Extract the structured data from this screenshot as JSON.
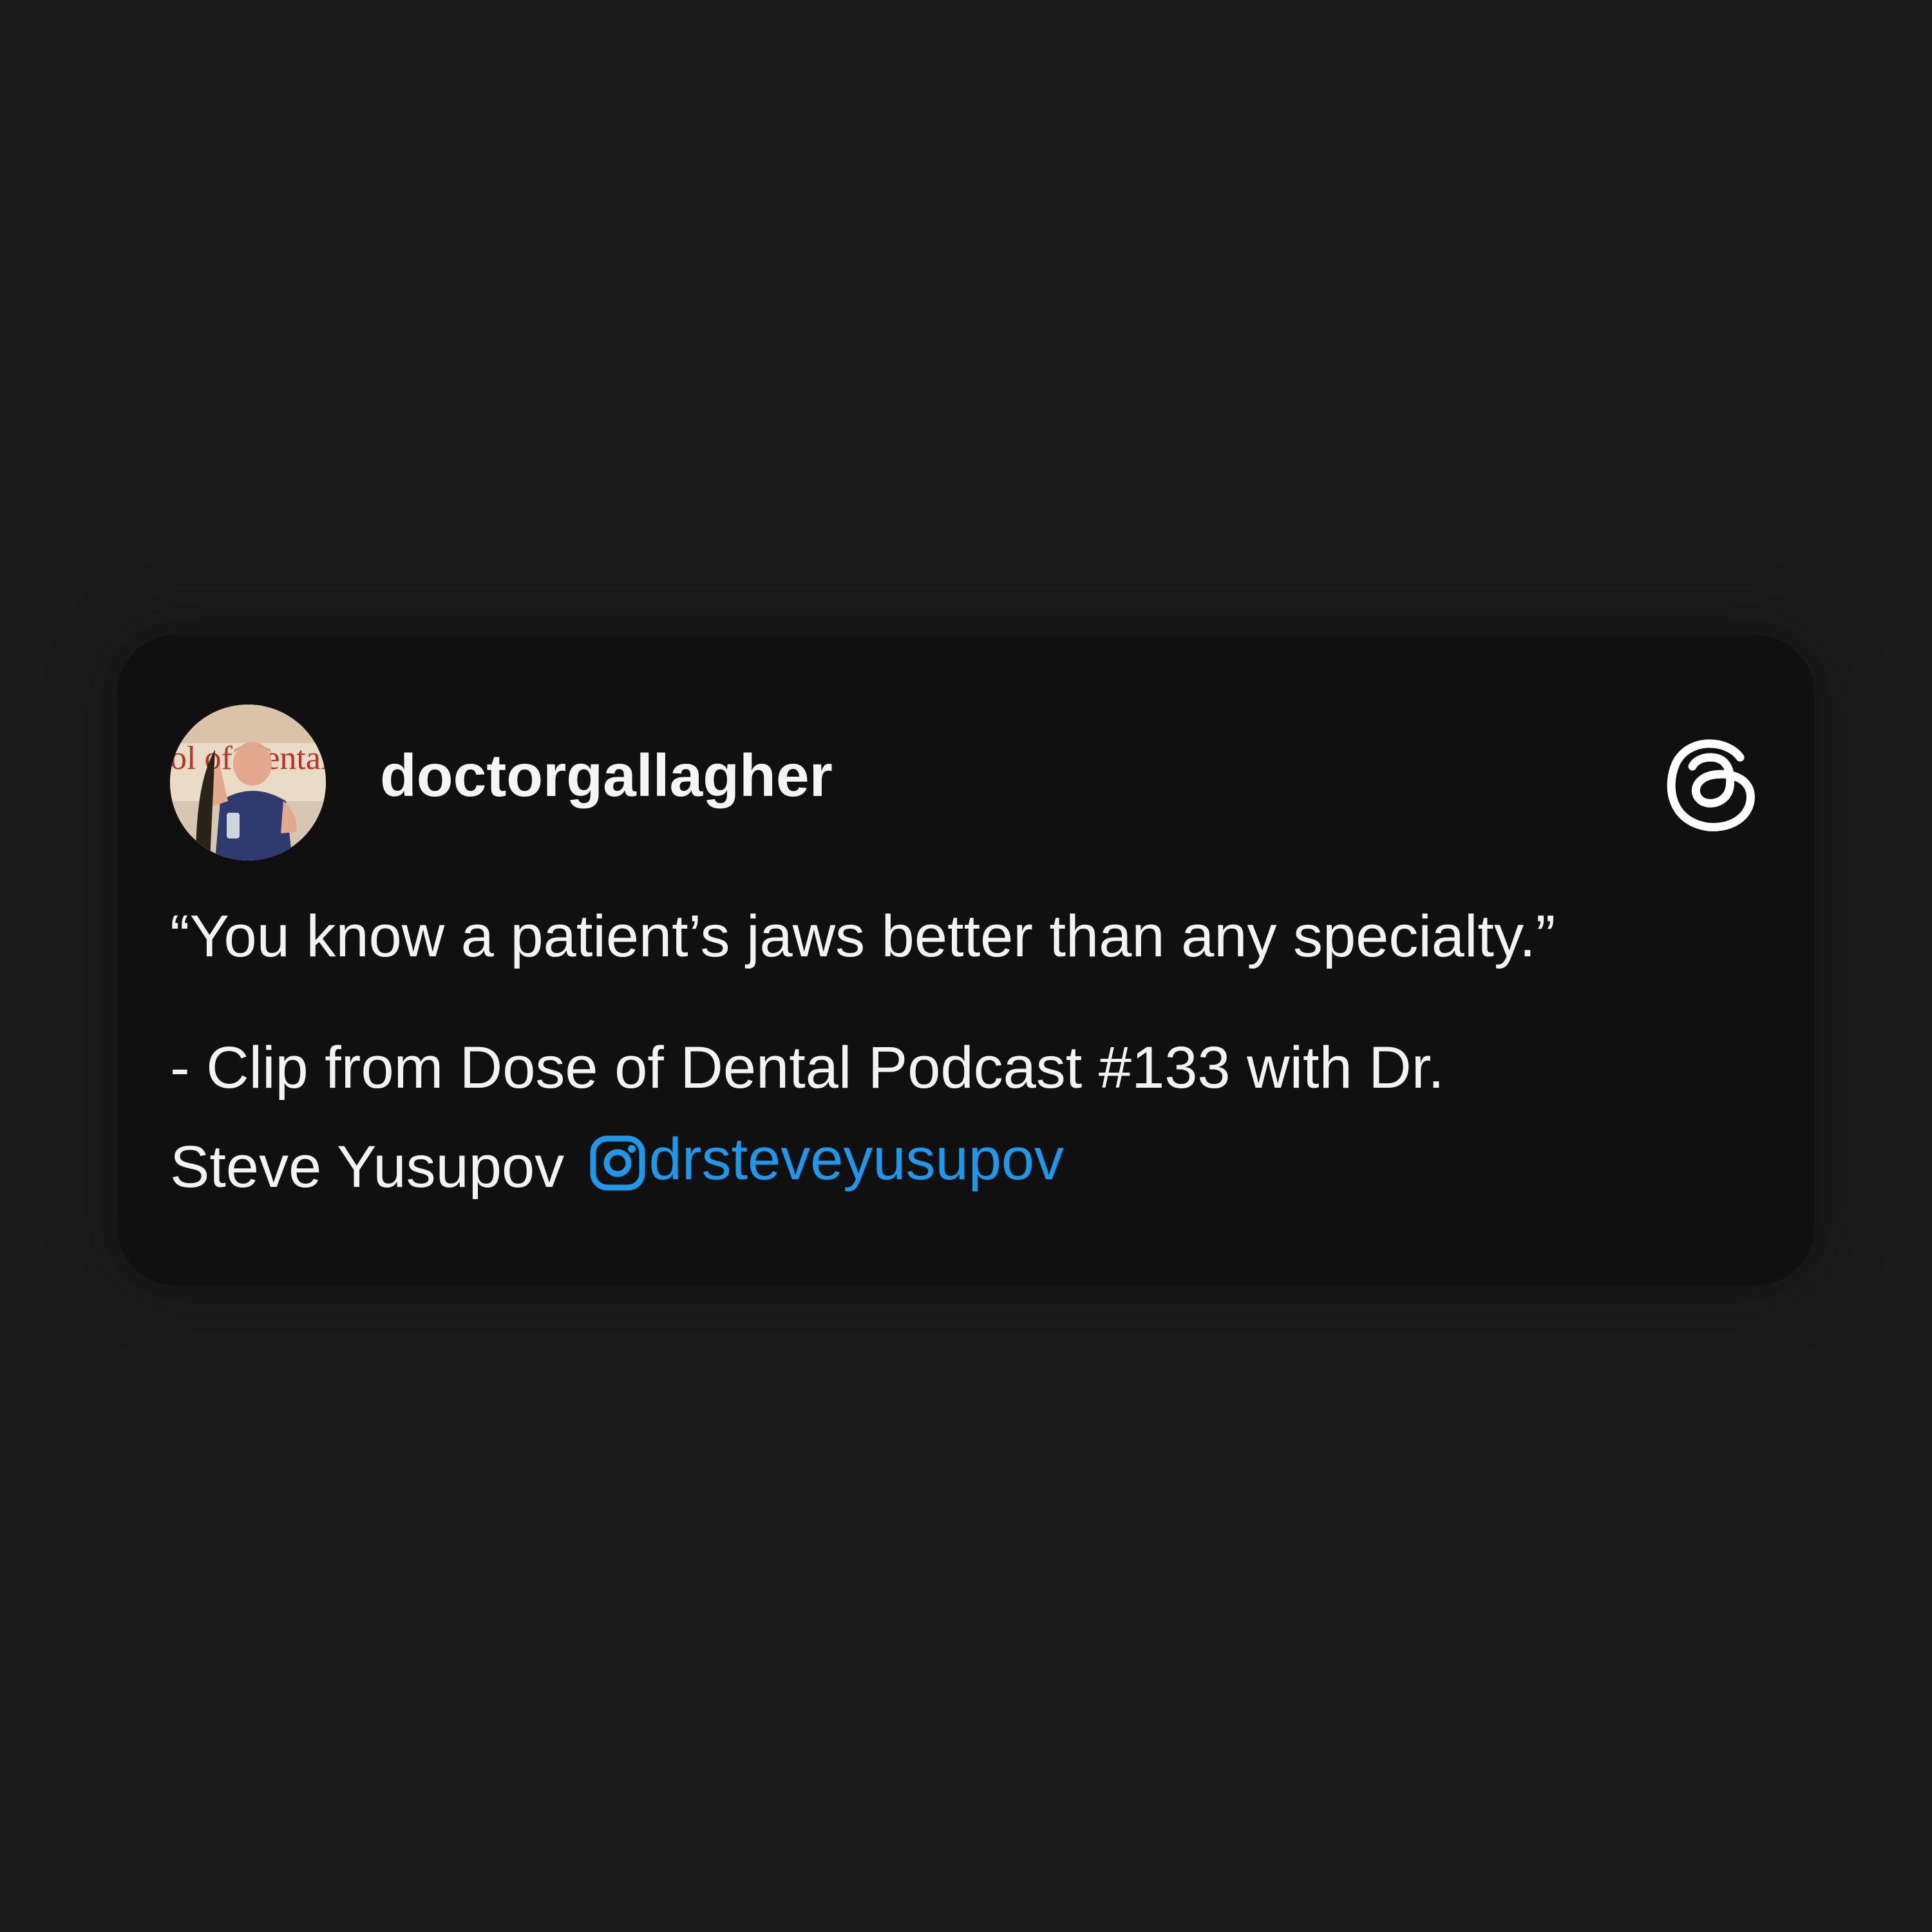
{
  "post": {
    "username": "doctorgallagher",
    "quote": "“You know a patient’s jaws better than any specialty.”",
    "clip_text_line1": "- Clip from Dose of Dental Podcast #133 with Dr.",
    "clip_text_line2": "Steve Yusupov",
    "mention_handle": "drsteveyusupov",
    "mention_icon": "instagram-icon",
    "brand_icon": "threads-icon",
    "avatar_image_text": "ol of Dental"
  },
  "colors": {
    "page_background": "#1b1b1c",
    "card_background": "#101010",
    "text": "#f3f3f3",
    "mention": "#1d98ea"
  }
}
